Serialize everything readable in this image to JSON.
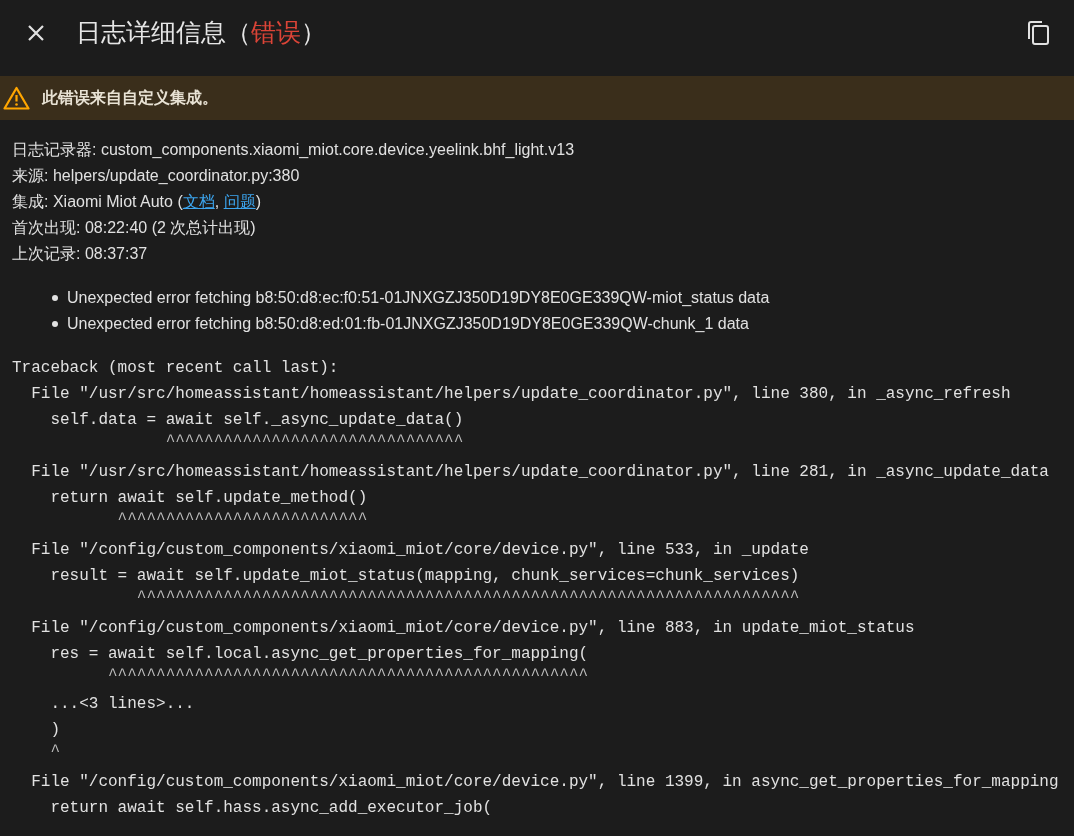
{
  "header": {
    "title_prefix": "日志详细信息（",
    "severity": "错误",
    "title_suffix": "）"
  },
  "warning": {
    "text": "此错误来自自定义集成。"
  },
  "details": [
    {
      "label": "日志记录器:",
      "parts": [
        {
          "kind": "text",
          "text": "custom_components.xiaomi_miot.core.device.yeelink.bhf_light.v13"
        }
      ]
    },
    {
      "label": "来源:",
      "parts": [
        {
          "kind": "text",
          "text": "helpers/update_coordinator.py:380"
        }
      ]
    },
    {
      "label": "集成:",
      "parts": [
        {
          "kind": "text",
          "text": "Xiaomi Miot Auto ("
        },
        {
          "kind": "link",
          "text": "文档"
        },
        {
          "kind": "text",
          "text": ", "
        },
        {
          "kind": "link",
          "text": "问题"
        },
        {
          "kind": "text",
          "text": ")"
        }
      ]
    },
    {
      "label": "首次出现:",
      "parts": [
        {
          "kind": "text",
          "text": "08:22:40 (2 次总计出现)"
        }
      ]
    },
    {
      "label": "上次记录:",
      "parts": [
        {
          "kind": "text",
          "text": "08:37:37"
        }
      ]
    }
  ],
  "messages": [
    "Unexpected error fetching b8:50:d8:ec:f0:51-01JNXGZJ350D19DY8E0GE339QW-miot_status data",
    "Unexpected error fetching b8:50:d8:ed:01:fb-01JNXGZJ350D19DY8E0GE339QW-chunk_1 data"
  ],
  "traceback": {
    "header": "Traceback (most recent call last):",
    "frames": [
      {
        "location": "  File \"/usr/src/homeassistant/homeassistant/helpers/update_coordinator.py\", line 380, in _async_refresh",
        "segments": [
          [
            {
              "kind": "code",
              "text": "    self.data = await self._async_update_data()"
            },
            {
              "kind": "caret",
              "text": "                ^^^^^^^^^^^^^^^^^^^^^^^^^^^^^^^"
            }
          ]
        ]
      },
      {
        "location": "  File \"/usr/src/homeassistant/homeassistant/helpers/update_coordinator.py\", line 281, in _async_update_data",
        "segments": [
          [
            {
              "kind": "code",
              "text": "    return await self.update_method()"
            },
            {
              "kind": "caret",
              "text": "           ^^^^^^^^^^^^^^^^^^^^^^^^^^"
            }
          ]
        ]
      },
      {
        "location": "  File \"/config/custom_components/xiaomi_miot/core/device.py\", line 533, in _update",
        "segments": [
          [
            {
              "kind": "code",
              "text": "    result = await self.update_miot_status(mapping, chunk_services=chunk_services)"
            },
            {
              "kind": "caret",
              "text": "             ^^^^^^^^^^^^^^^^^^^^^^^^^^^^^^^^^^^^^^^^^^^^^^^^^^^^^^^^^^^^^^^^^^^^^"
            }
          ]
        ]
      },
      {
        "location": "  File \"/config/custom_components/xiaomi_miot/core/device.py\", line 883, in update_miot_status",
        "segments": [
          [
            {
              "kind": "code",
              "text": "    res = await self.local.async_get_properties_for_mapping("
            },
            {
              "kind": "caret",
              "text": "          ^^^^^^^^^^^^^^^^^^^^^^^^^^^^^^^^^^^^^^^^^^^^^^^^^^"
            }
          ],
          [
            {
              "kind": "code",
              "text": "    ...<3 lines>..."
            },
            {
              "kind": "code",
              "text": "    )"
            },
            {
              "kind": "caret",
              "text": "    ^"
            }
          ]
        ]
      },
      {
        "location": "  File \"/config/custom_components/xiaomi_miot/core/device.py\", line 1399, in async_get_properties_for_mapping",
        "segments": [
          [
            {
              "kind": "code",
              "text": "    return await self.hass.async_add_executor_job("
            }
          ]
        ]
      }
    ]
  }
}
